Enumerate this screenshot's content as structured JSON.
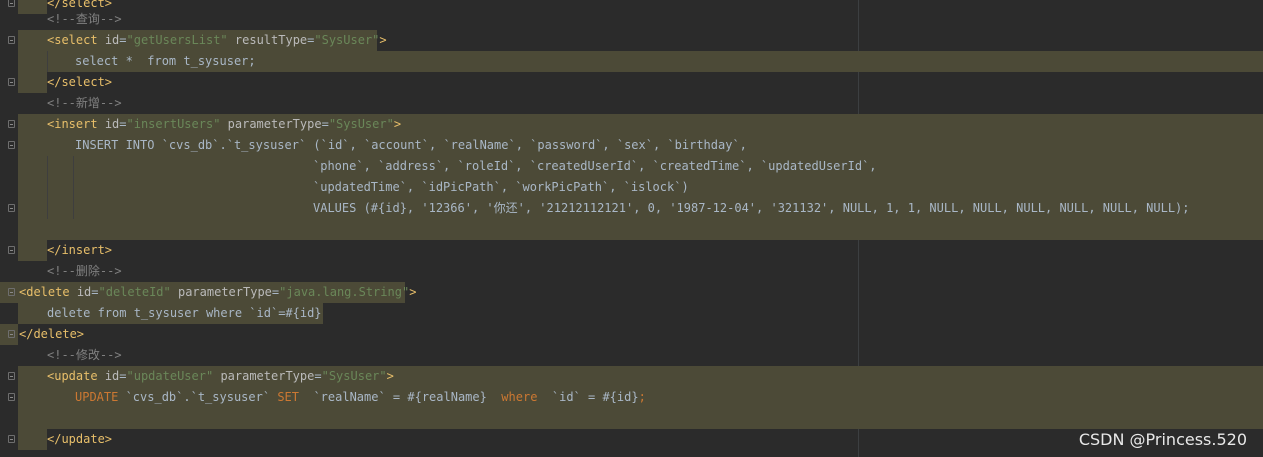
{
  "editor": {
    "lines": [
      {
        "t": "</select>"
      },
      {
        "t": "<!--查询-->"
      },
      {
        "t": "<select id=\"getUsersList\" resultType=\"SysUser\">"
      },
      {
        "t": "select *  from t_sysuser;"
      },
      {
        "t": "</select>"
      },
      {
        "t": "<!--新增-->"
      },
      {
        "t": "<insert id=\"insertUsers\" parameterType=\"SysUser\">"
      },
      {
        "t": "INSERT INTO `cvs_db`.`t_sysuser` (`id`, `account`, `realName`, `password`, `sex`, `birthday`,"
      },
      {
        "t": "`phone`, `address`, `roleId`, `createdUserId`, `createdTime`, `updatedUserId`,"
      },
      {
        "t": "`updatedTime`, `idPicPath`, `workPicPath`, `islock`)"
      },
      {
        "t": "VALUES (#{id}, '12366', '你还', '21212112121', 0, '1987-12-04', '321132', NULL, 1, 1, NULL, NULL, NULL, NULL, NULL, NULL);"
      },
      {
        "t": ""
      },
      {
        "t": "</insert>"
      },
      {
        "t": "<!--删除-->"
      },
      {
        "t": "<delete id=\"deleteId\" parameterType=\"java.lang.String\">"
      },
      {
        "t": "delete from t_sysuser where `id`=#{id}"
      },
      {
        "t": "</delete>"
      },
      {
        "t": "<!--修改-->"
      },
      {
        "t": "<update id=\"updateUser\" parameterType=\"SysUser\">"
      },
      {
        "t": "UPDATE `cvs_db`.`t_sysuser` SET  `realName` = #{realName}  where  `id` = #{id};"
      },
      {
        "t": ""
      },
      {
        "t": "</update>"
      }
    ]
  },
  "watermark": "CSDN @Princess.520"
}
